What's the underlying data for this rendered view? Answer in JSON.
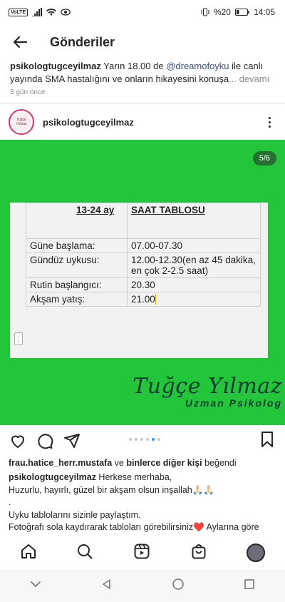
{
  "status_bar": {
    "network": "VoLTE",
    "battery": "%20",
    "time": "14:05"
  },
  "header": {
    "title": "Gönderiler"
  },
  "previous_post": {
    "username": "psikologtugceyilmaz",
    "caption_before": " Yarın 18.00 de ",
    "mention": "@dreamofoyku",
    "caption_after": "  ile canlı yayında SMA hastalığını ve onların hikayesini konuşa",
    "more": "... devamı",
    "timestamp": "3 gün önce"
  },
  "post": {
    "username": "psikologtugceyilmaz",
    "avatar_text": "Tuğçe Yılmaz",
    "page_indicator": "5/6",
    "table": {
      "header": [
        "13-24 ay",
        "SAAT TABLOSU"
      ],
      "rows": [
        [
          "Güne başlama:",
          "07.00-07.30"
        ],
        [
          "Gündüz uykusu:",
          "12.00-12.30(en az 45 dakika, en çok 2-2.5 saat)"
        ],
        [
          "Rutin başlangıcı:",
          "20.30"
        ],
        [
          "Akşam yatış:",
          "21.00"
        ]
      ]
    },
    "signature": {
      "name": "Tuğçe Yılmaz",
      "subtitle": "Uzman Psikolog"
    },
    "carousel": {
      "total": 6,
      "active_index": 4
    },
    "likes": {
      "user": "frau.hatice_herr.mustafa",
      "middle": " ve ",
      "others": "binlerce diğer kişi",
      "suffix": " beğendi"
    },
    "caption": {
      "username": "psikologtugceyilmaz",
      "line1": " Herkese merhaba,",
      "line2": "Huzurlu, hayırlı, güzel bir akşam olsun inşallah🙏🏻🙏🏻",
      "line3": ".",
      "line4": "Uyku tablolarını sizinle paylaştım.",
      "line5": "Fotoğrafı sola kaydırarak tabloları görebilirsiniz❤️ Aylarına göre"
    }
  },
  "colors": {
    "post_background": "#23c53a",
    "accent": "#3897f0",
    "signature": "#0d3a33"
  }
}
